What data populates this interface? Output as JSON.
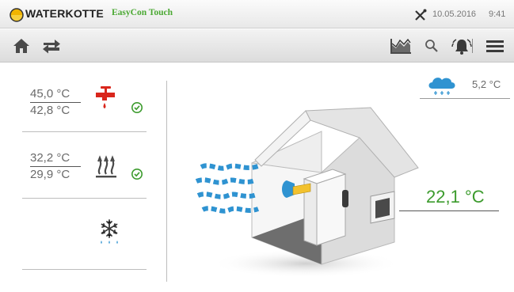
{
  "statusbar": {
    "brand": "WATERKOTTE",
    "product": "EasyCon Touch",
    "date": "10.05.2016",
    "time": "9:41"
  },
  "toolbar": {
    "icons": [
      "home-icon",
      "switch-arrows-icon",
      "chart-icon",
      "search-icon",
      "alarm-icon",
      "menu-icon"
    ]
  },
  "hot_water": {
    "actual": "45,0 °C",
    "setpoint": "42,8 °C",
    "icon": "faucet-icon",
    "status_icon": "check-circle-icon"
  },
  "heating": {
    "actual": "32,2 °C",
    "setpoint": "29,9 °C",
    "icon": "heating-icon",
    "status_icon": "check-circle-icon"
  },
  "cooling": {
    "icon": "snowflake-icon"
  },
  "outdoor": {
    "temperature": "5,2 °C",
    "icon": "snow-cloud-icon"
  },
  "room": {
    "temperature": "22,1 °C"
  },
  "colors": {
    "brand_green": "#4aa832",
    "hot_water_red": "#d9261c",
    "status_green": "#3c9b2d",
    "sky_blue": "#2f93d1"
  }
}
